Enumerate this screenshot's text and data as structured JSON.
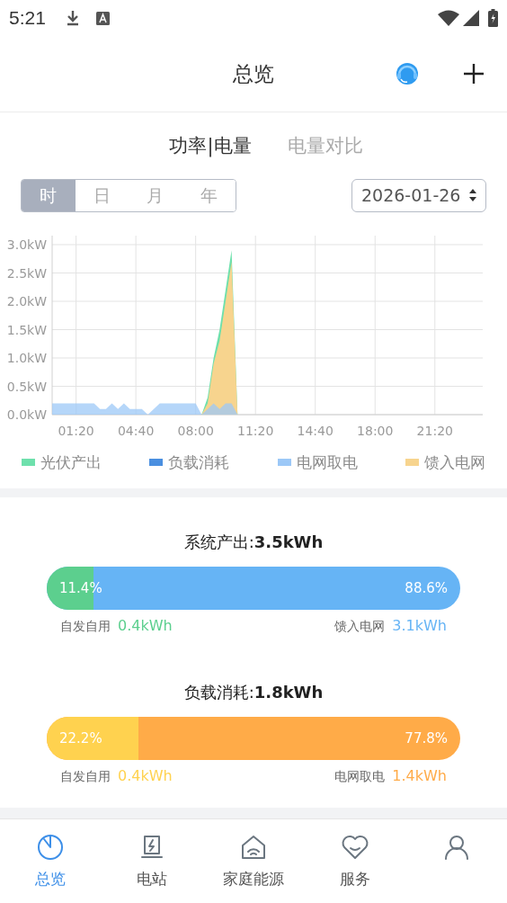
{
  "status_bar": {
    "time": "5:21"
  },
  "header": {
    "title": "总览"
  },
  "view_tabs": [
    {
      "label": "功率|电量",
      "selected": true
    },
    {
      "label": "电量对比",
      "selected": false
    }
  ],
  "period_tabs": [
    {
      "label": "时",
      "selected": true
    },
    {
      "label": "日",
      "selected": false
    },
    {
      "label": "月",
      "selected": false
    },
    {
      "label": "年",
      "selected": false
    }
  ],
  "date_picker": {
    "value": "2026-01-26"
  },
  "chart_data": {
    "type": "area",
    "grid": true,
    "legend": true,
    "x": [
      0,
      20,
      40,
      60,
      80,
      100,
      120,
      140,
      160,
      180,
      200,
      220,
      240,
      260,
      280,
      300,
      320,
      340,
      360,
      380,
      400,
      420,
      440,
      460,
      480,
      500,
      520,
      540,
      560,
      580,
      600,
      620,
      640
    ],
    "xlim": [
      0,
      1440
    ],
    "ylim": [
      0,
      3.0
    ],
    "xticks": [
      {
        "value": 80,
        "label": "01:20"
      },
      {
        "value": 280,
        "label": "04:40"
      },
      {
        "value": 480,
        "label": "08:00"
      },
      {
        "value": 680,
        "label": "11:20"
      },
      {
        "value": 880,
        "label": "14:40"
      },
      {
        "value": 1080,
        "label": "18:00"
      },
      {
        "value": 1280,
        "label": "21:20"
      }
    ],
    "yticks": [
      {
        "value": 0,
        "label": "0.0kW"
      },
      {
        "value": 0.5,
        "label": "0.5kW"
      },
      {
        "value": 1,
        "label": "1.0kW"
      },
      {
        "value": 1.5,
        "label": "1.5kW"
      },
      {
        "value": 2,
        "label": "2.0kW"
      },
      {
        "value": 2.5,
        "label": "2.5kW"
      },
      {
        "value": 3,
        "label": "3.0kW"
      }
    ],
    "series": [
      {
        "name": "光伏产出",
        "color": "#6ee0ac",
        "values": [
          0,
          0,
          0,
          0,
          0,
          0,
          0,
          0,
          0,
          0,
          0,
          0,
          0,
          0,
          0,
          0,
          0,
          0,
          0,
          0,
          0,
          0,
          0,
          0,
          0,
          0,
          0.3,
          1.0,
          1.5,
          2.2,
          2.9,
          0,
          0
        ]
      },
      {
        "name": "负载消耗",
        "color": "#4a8fe0",
        "values": [
          null,
          null,
          null,
          null,
          null,
          null,
          null,
          null,
          null,
          null,
          null,
          null,
          null,
          null,
          null,
          null,
          null,
          null,
          null,
          null,
          null,
          null,
          null,
          null,
          null,
          null,
          null,
          null,
          null,
          null,
          null,
          null,
          null
        ]
      },
      {
        "name": "电网取电",
        "color": "#9cc8f7",
        "values": [
          0.2,
          0.2,
          0.2,
          0.2,
          0.2,
          0.2,
          0.2,
          0.2,
          0.1,
          0.1,
          0.2,
          0.1,
          0.2,
          0.1,
          0.1,
          0.1,
          0,
          0.1,
          0.2,
          0.2,
          0.2,
          0.2,
          0.2,
          0.2,
          0.2,
          0,
          0.1,
          0.2,
          0.1,
          0.2,
          0.2,
          0,
          0
        ]
      },
      {
        "name": "馈入电网",
        "color": "#f7d48e",
        "values": [
          0,
          0,
          0,
          0,
          0,
          0,
          0,
          0,
          0,
          0,
          0,
          0,
          0,
          0,
          0,
          0,
          0,
          0,
          0,
          0,
          0,
          0,
          0,
          0,
          0,
          0,
          0.2,
          0.9,
          1.3,
          2.0,
          2.7,
          0,
          0
        ]
      }
    ]
  },
  "summaries": [
    {
      "title": "系统产出:**3.5kWh**",
      "level": 0.114,
      "segments": [
        {
          "label": "11.4%",
          "color": "#5ccf8e"
        },
        {
          "label": "88.6%",
          "color": "#66b4f5"
        }
      ],
      "captions": [
        {
          "label": "自发自用",
          "value": "0.4kWh"
        },
        {
          "label": "馈入电网",
          "value": "3.1kWh"
        }
      ]
    },
    {
      "title": "负载消耗:**1.8kWh**",
      "level": 0.222,
      "segments": [
        {
          "label": "22.2%",
          "color": "#ffd24f"
        },
        {
          "label": "77.8%",
          "color": "#ffab48"
        }
      ],
      "captions": [
        {
          "label": "自发自用",
          "value": "0.4kWh"
        },
        {
          "label": "电网取电",
          "value": "1.4kWh"
        }
      ]
    }
  ],
  "bottom_nav": [
    {
      "kind": "overview",
      "label": "总览",
      "selected": true
    },
    {
      "kind": "station",
      "label": "电站",
      "selected": false
    },
    {
      "kind": "home",
      "label": "家庭能源",
      "selected": false
    },
    {
      "kind": "service",
      "label": "服务",
      "selected": false
    },
    {
      "kind": "user",
      "selected": false
    }
  ]
}
